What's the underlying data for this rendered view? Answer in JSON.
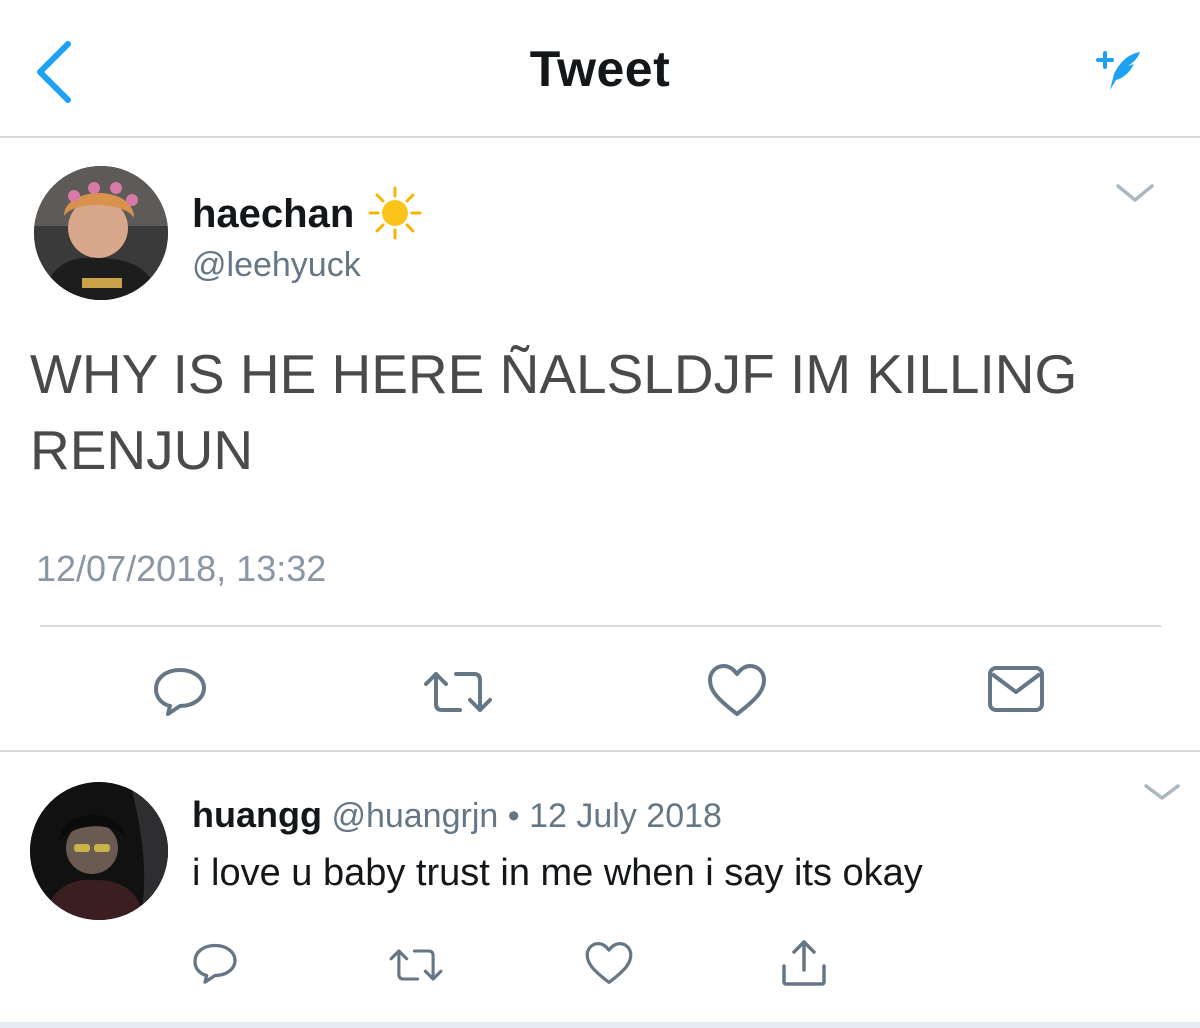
{
  "header": {
    "title": "Tweet",
    "back_icon": "chevron-left-icon",
    "compose_icon": "compose-tweet-icon"
  },
  "main_tweet": {
    "display_name": "haechan",
    "name_emoji": "sun-icon",
    "handle": "@leehyuck",
    "text": "WHY IS HE HERE ÑALSLDJF IM KILLING RENJUN",
    "timestamp": "12/07/2018, 13:32",
    "actions": [
      "reply-icon",
      "retweet-icon",
      "like-icon",
      "direct-message-icon"
    ]
  },
  "reply": {
    "display_name": "huangg",
    "handle": "@huangrjn",
    "separator": "•",
    "date": "12 July 2018",
    "text": "i love u baby trust in me when i say its okay",
    "actions": [
      "reply-icon",
      "retweet-icon",
      "like-icon",
      "share-icon"
    ]
  },
  "colors": {
    "accent": "#1da1f2",
    "text": "#14171a",
    "muted": "#657786",
    "icon": "#657786",
    "divider": "#d6d9dc"
  }
}
